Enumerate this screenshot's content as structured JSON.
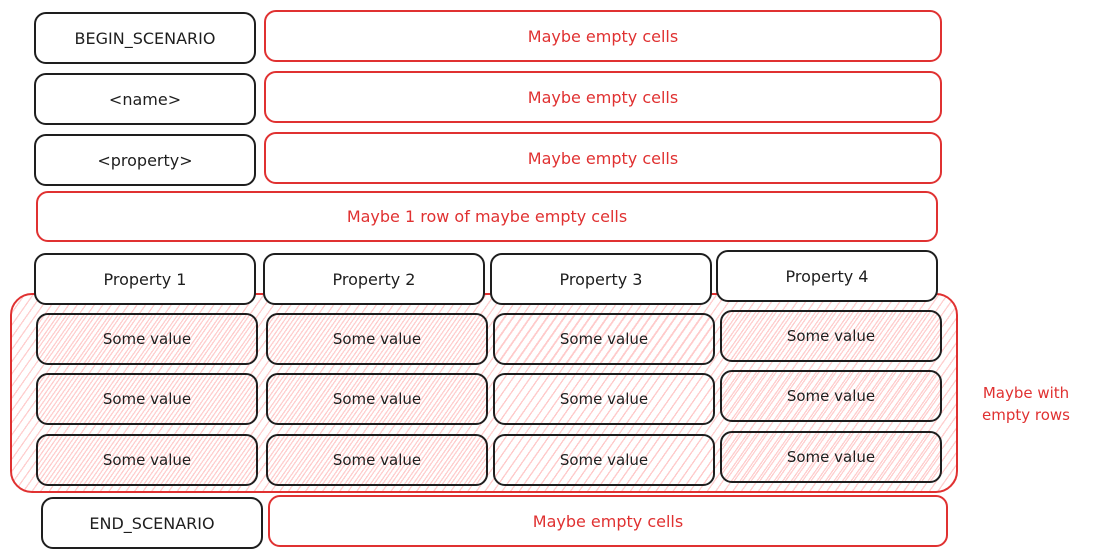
{
  "rows": {
    "begin": {
      "label": "BEGIN_SCENARIO",
      "note": "Maybe empty cells"
    },
    "name": {
      "label": "<name>",
      "note": "Maybe empty cells"
    },
    "property": {
      "label": "<property>",
      "note": "Maybe empty cells"
    },
    "optional_row": {
      "note": "Maybe 1 row of maybe empty cells"
    },
    "end": {
      "label": "END_SCENARIO",
      "note": "Maybe empty cells"
    }
  },
  "table": {
    "headers": [
      "Property 1",
      "Property 2",
      "Property 3",
      "Property 4"
    ],
    "rows": [
      [
        "Some value",
        "Some value",
        "Some value",
        "Some value"
      ],
      [
        "Some value",
        "Some value",
        "Some value",
        "Some value"
      ],
      [
        "Some value",
        "Some value",
        "Some value",
        "Some value"
      ]
    ],
    "annotation": "Maybe with empty rows"
  },
  "colors": {
    "stroke": "#1e1e1e",
    "accent": "#e03131",
    "hatch": "#ffc9c9"
  }
}
